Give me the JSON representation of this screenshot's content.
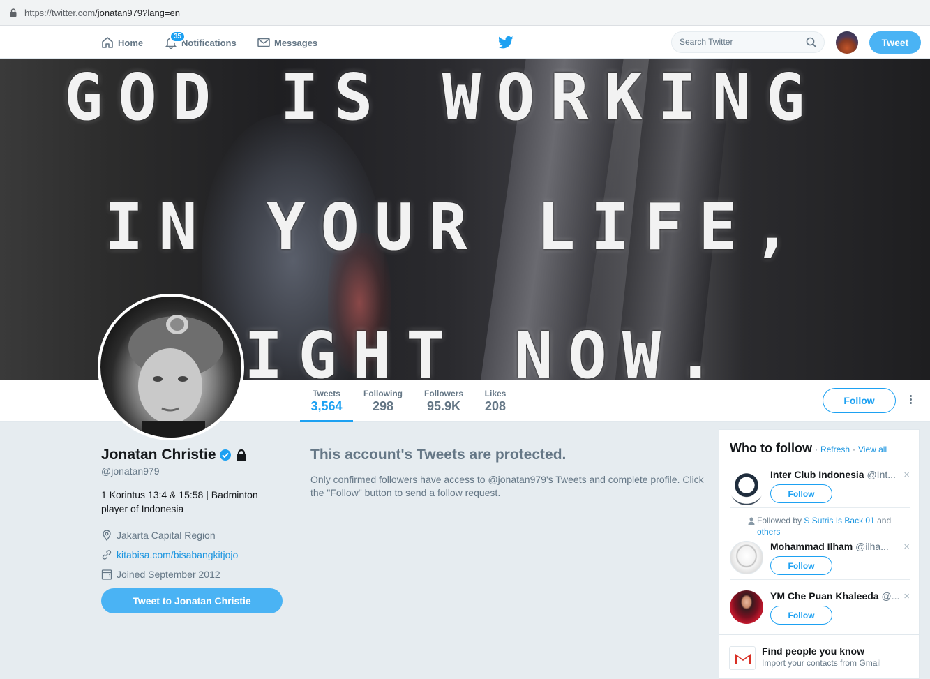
{
  "browser": {
    "url_host": "https://twitter.com",
    "url_path": "/jonatan979?lang=en"
  },
  "nav": {
    "home": "Home",
    "notifications": "Notifications",
    "notifications_count": "35",
    "messages": "Messages",
    "search_placeholder": "Search Twitter",
    "tweet": "Tweet"
  },
  "banner": {
    "line1": "GOD IS WORKING",
    "line2": "IN YOUR LIFE,",
    "line3": "IGHT NOW."
  },
  "stats": {
    "tweets_label": "Tweets",
    "tweets": "3,564",
    "following_label": "Following",
    "following": "298",
    "followers_label": "Followers",
    "followers": "95.9K",
    "likes_label": "Likes",
    "likes": "208"
  },
  "profile": {
    "follow": "Follow",
    "name": "Jonatan Christie",
    "handle": "@jonatan979",
    "bio": "1 Korintus 13:4 & 15:58 | Badminton player of Indonesia",
    "location": "Jakarta Capital Region",
    "website": "kitabisa.com/bisabangkitjojo",
    "joined": "Joined September 2012",
    "tweet_to": "Tweet to Jonatan Christie"
  },
  "protected": {
    "title": "This account's Tweets are protected.",
    "body": "Only confirmed followers have access to @jonatan979's Tweets and complete profile. Click the \"Follow\" button to send a follow request."
  },
  "who_to_follow": {
    "title": "Who to follow",
    "refresh": "Refresh",
    "view_all": "View all",
    "follow_label": "Follow",
    "close": "×",
    "suggestions": [
      {
        "name": "Inter Club Indonesia",
        "handle": "@Int..."
      },
      {
        "name": "Mohammad Ilham",
        "handle": "@ilha..."
      },
      {
        "name": "YM Che Puan Khaleeda",
        "handle": "@..."
      }
    ],
    "context_prefix": "Followed by",
    "context_user": "S Sutris Is Back 01",
    "context_and": "and",
    "context_others": "others",
    "find_title": "Find people you know",
    "find_sub": "Import your contacts from Gmail"
  }
}
